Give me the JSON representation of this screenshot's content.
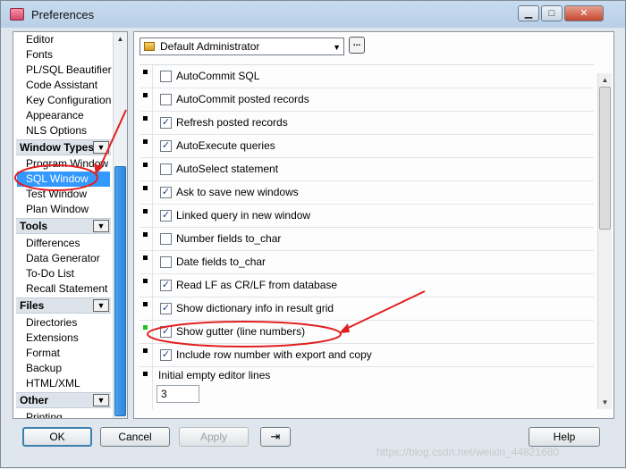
{
  "window": {
    "title": "Preferences"
  },
  "nav": {
    "items_top": [
      "Editor",
      "Fonts",
      "PL/SQL Beautifier",
      "Code Assistant",
      "Key Configuration",
      "Appearance",
      "NLS Options"
    ],
    "group_window_types": {
      "label": "Window Types",
      "items": [
        "Program Window",
        "SQL Window",
        "Test Window",
        "Plan Window"
      ],
      "selected": "SQL Window"
    },
    "group_tools": {
      "label": "Tools",
      "items": [
        "Differences",
        "Data Generator",
        "To-Do List",
        "Recall Statement"
      ]
    },
    "group_files": {
      "label": "Files",
      "items": [
        "Directories",
        "Extensions",
        "Format",
        "Backup",
        "HTML/XML"
      ]
    },
    "group_other": {
      "label": "Other",
      "items": [
        "Printing"
      ]
    }
  },
  "profile": {
    "selected": "Default Administrator",
    "ellipsis": "..."
  },
  "options": [
    {
      "label": "AutoCommit SQL",
      "checked": false
    },
    {
      "label": "AutoCommit posted records",
      "checked": false
    },
    {
      "label": "Refresh posted records",
      "checked": true
    },
    {
      "label": "AutoExecute queries",
      "checked": true
    },
    {
      "label": "AutoSelect statement",
      "checked": false
    },
    {
      "label": "Ask to save new windows",
      "checked": true
    },
    {
      "label": "Linked query in new window",
      "checked": true
    },
    {
      "label": "Number fields to_char",
      "checked": false
    },
    {
      "label": "Date fields to_char",
      "checked": false
    },
    {
      "label": "Read LF as CR/LF from database",
      "checked": true
    },
    {
      "label": "Show dictionary info in result grid",
      "checked": true
    },
    {
      "label": "Show gutter (line numbers)",
      "checked": true
    },
    {
      "label": "Include row number with export and copy",
      "checked": true
    }
  ],
  "editor_lines": {
    "label": "Initial empty editor lines",
    "value": "3"
  },
  "buttons": {
    "ok": "OK",
    "cancel": "Cancel",
    "apply": "Apply",
    "help": "Help"
  },
  "watermark": "https://blog.csdn.net/weixin_44821680",
  "accent_colors": {
    "selection": "#3399ff",
    "annotation": "#e02020",
    "modified_marker": "#22c022"
  }
}
